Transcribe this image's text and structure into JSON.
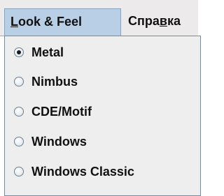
{
  "menubar": {
    "menus": [
      {
        "label_mnemonic": "L",
        "label_rest": "ook & Feel",
        "selected": true
      },
      {
        "label_prefix": "Спра",
        "label_mnemonic": "в",
        "label_suffix": "ка",
        "selected": false
      }
    ]
  },
  "look_and_feel_menu": {
    "items": [
      {
        "label": "Metal",
        "checked": true
      },
      {
        "label": "Nimbus",
        "checked": false
      },
      {
        "label": "CDE/Motif",
        "checked": false
      },
      {
        "label": "Windows",
        "checked": false
      },
      {
        "label": "Windows Classic",
        "checked": false
      }
    ]
  },
  "colors": {
    "selected_menu_bg": "#b8cfe5",
    "menubar_bg": "#eceaea",
    "popup_bg": "#eeeeee"
  }
}
